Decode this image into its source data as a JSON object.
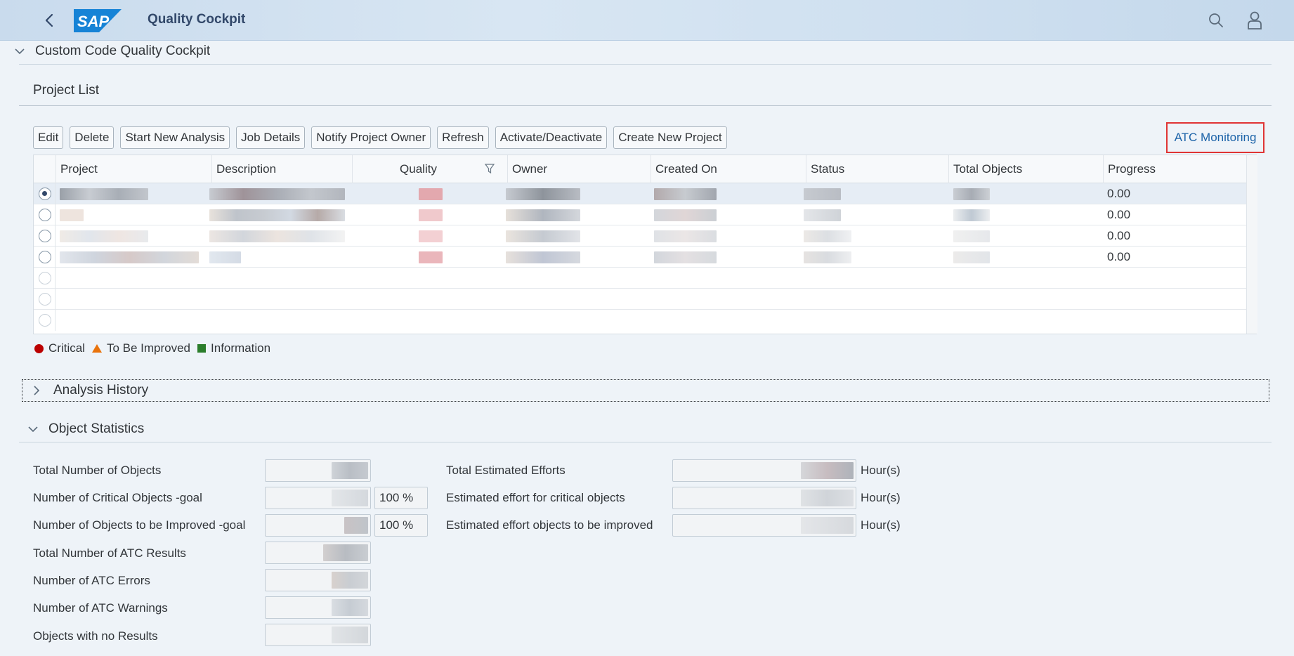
{
  "header": {
    "app_title": "Quality Cockpit",
    "logo_text": "SAP"
  },
  "page": {
    "section_title": "Custom Code Quality Cockpit",
    "project_list_title": "Project List"
  },
  "toolbar": {
    "buttons": [
      "Edit",
      "Delete",
      "Start New Analysis",
      "Job Details",
      "Notify Project Owner",
      "Refresh",
      "Activate/Deactivate",
      "Create New Project"
    ],
    "atc_link": "ATC Monitoring",
    "highlight_color": "#e03434"
  },
  "table": {
    "columns": [
      "Project",
      "Description",
      "Quality",
      "Owner",
      "Created On",
      "Status",
      "Total Objects",
      "Progress"
    ],
    "rows": [
      {
        "progress": "0.00",
        "selected": true
      },
      {
        "progress": "0.00",
        "selected": false
      },
      {
        "progress": "0.00",
        "selected": false
      },
      {
        "progress": "0.00",
        "selected": false
      }
    ],
    "empty_rows": 3
  },
  "legend": {
    "critical": "Critical",
    "to_be_improved": "To Be Improved",
    "information": "Information",
    "colors": {
      "critical": "#bb0000",
      "to_be_improved": "#e9730c",
      "information": "#2b7d2b"
    }
  },
  "analysis_history": {
    "title": "Analysis History"
  },
  "object_statistics": {
    "title": "Object Statistics",
    "left_labels": [
      "Total Number of Objects",
      "Number of Critical Objects -goal",
      "Number of Objects to be Improved -goal",
      "Total Number of ATC Results",
      "Number of ATC Errors",
      "Number of ATC Warnings",
      "Objects with no Results"
    ],
    "critical_goal_pct": "100 %",
    "improved_goal_pct": "100 %",
    "right_labels": [
      "Total Estimated Efforts",
      "Estimated effort for critical objects",
      "Estimated effort objects to be improved"
    ],
    "unit": "Hour(s)"
  }
}
